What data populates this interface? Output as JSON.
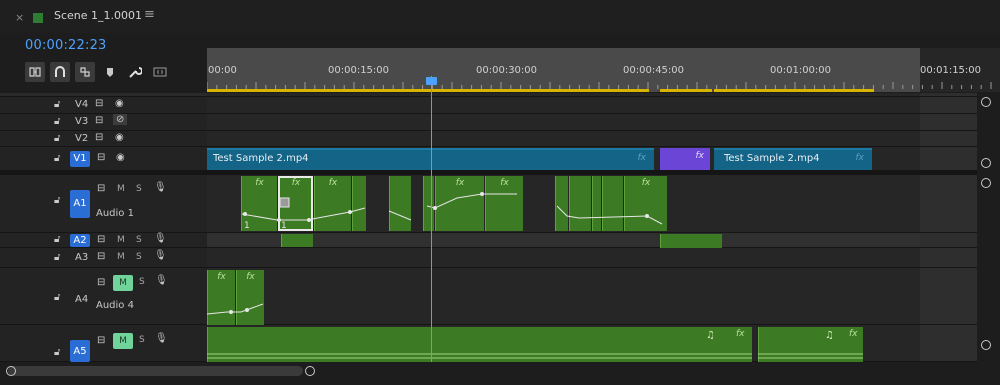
{
  "panel": {
    "close_icon": "×",
    "sequence_name": "Scene 1_1.0001",
    "menu_icon": "≡",
    "timecode": "00:00:22:23"
  },
  "ruler": {
    "labels": [
      "00:00",
      "00:00:15:00",
      "00:00:30:00",
      "00:00:45:00",
      "00:01:00:00",
      "00:01:15:00"
    ]
  },
  "tracks": {
    "v4": "V4",
    "v3": "V3",
    "v2": "V2",
    "v1": "V1",
    "a1": "A1",
    "a1_name": "Audio 1",
    "a2": "A2",
    "a3": "A3",
    "a4": "A4",
    "a4_name": "Audio 4",
    "a5": "A5",
    "mute": "M",
    "solo": "S"
  },
  "clips": {
    "v1_clip1": "Test Sample 2.mp4",
    "v1_clip2": "Test Sample 2.mp4",
    "fx": "fx",
    "note": "♫"
  },
  "icons": {
    "lock": "lock-icon",
    "sync": "sync-lock-icon",
    "eye": "eye-icon",
    "eye_hidden": "eye-hidden-icon",
    "mic": "microphone-icon"
  },
  "colors": {
    "accent": "#4ea1ff",
    "video_clip": "#146487",
    "audio_clip": "#3d7a24",
    "transition": "#6b45d6",
    "active_track": "#2a6dd4",
    "mute_on": "#6fd39a"
  }
}
